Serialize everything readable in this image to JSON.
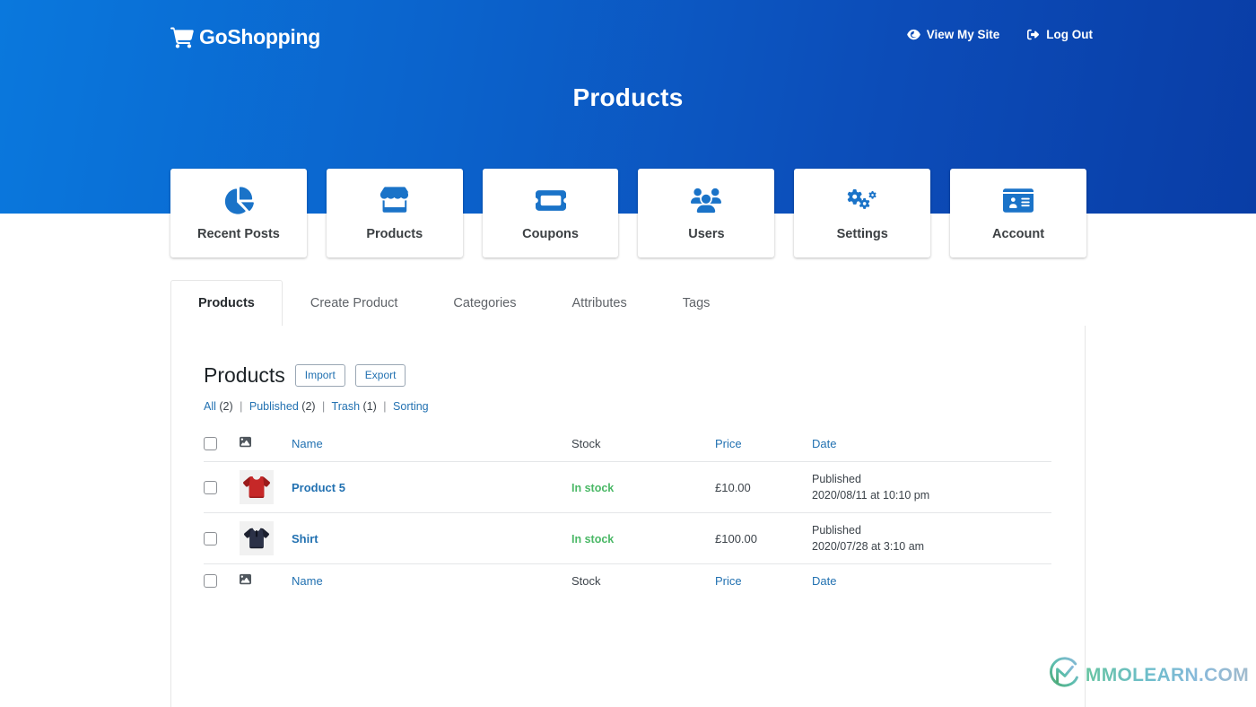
{
  "brand": {
    "name": "GoShopping",
    "icon": "shopping-cart-icon"
  },
  "topnav": [
    {
      "label": "View My Site",
      "icon": "eye-icon"
    },
    {
      "label": "Log Out",
      "icon": "sign-out-icon"
    }
  ],
  "banner": {
    "title": "Products",
    "gradient_from": "#0a78dd",
    "gradient_to": "#093da6"
  },
  "cards": [
    {
      "label": "Recent Posts",
      "icon": "pie-chart-icon"
    },
    {
      "label": "Products",
      "icon": "store-icon"
    },
    {
      "label": "Coupons",
      "icon": "ticket-icon"
    },
    {
      "label": "Users",
      "icon": "users-icon"
    },
    {
      "label": "Settings",
      "icon": "cogs-icon"
    },
    {
      "label": "Account",
      "icon": "id-card-icon"
    }
  ],
  "tabs": [
    {
      "label": "Products",
      "active": true
    },
    {
      "label": "Create Product",
      "active": false
    },
    {
      "label": "Categories",
      "active": false
    },
    {
      "label": "Attributes",
      "active": false
    },
    {
      "label": "Tags",
      "active": false
    }
  ],
  "content": {
    "title": "Products",
    "import_label": "Import",
    "export_label": "Export",
    "filters": [
      {
        "label": "All",
        "count": "(2)"
      },
      {
        "label": "Published",
        "count": "(2)"
      },
      {
        "label": "Trash",
        "count": "(1)"
      },
      {
        "label": "Sorting",
        "count": ""
      }
    ],
    "filter_separator": "|"
  },
  "table": {
    "columns": {
      "image": "image-icon",
      "name": "Name",
      "stock": "Stock",
      "price": "Price",
      "date": "Date"
    },
    "rows": [
      {
        "name": "Product 5",
        "thumb": "red-tshirt-thumbnail",
        "stock": "In stock",
        "price": "£10.00",
        "date_status": "Published",
        "date_value": "2020/08/11 at 10:10 pm"
      },
      {
        "name": "Shirt",
        "thumb": "navy-hoodie-thumbnail",
        "stock": "In stock",
        "price": "£100.00",
        "date_status": "Published",
        "date_value": "2020/07/28 at 3:10 am"
      }
    ]
  },
  "watermark": {
    "text": "MMOLEARN.COM",
    "icon": "mmolearn-swirl-logo"
  },
  "colors": {
    "accent_blue": "#1a73c8",
    "link_blue": "#2271b1",
    "in_stock_green": "#4ab866",
    "panel_border": "#e6e6e6"
  }
}
